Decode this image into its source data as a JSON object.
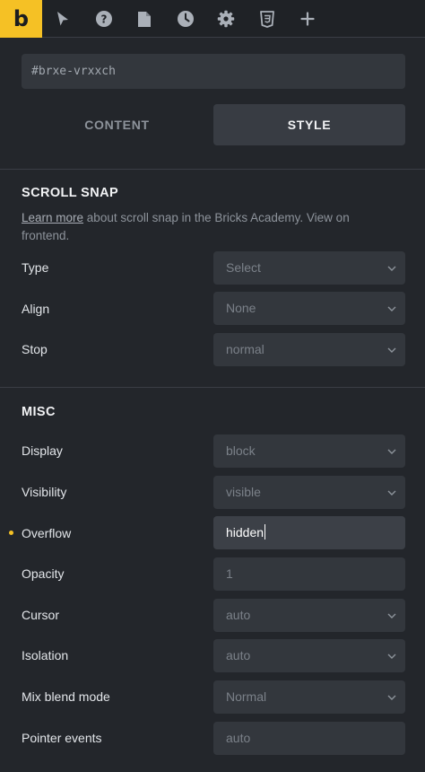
{
  "toolbar": {
    "logo_text": "b",
    "icons": [
      "pointer-icon",
      "help-icon",
      "page-icon",
      "history-icon",
      "settings-icon",
      "css-icon",
      "plus-icon"
    ]
  },
  "element_id": "#brxe-vrxxch",
  "tabs": [
    {
      "label": "CONTENT"
    },
    {
      "label": "STYLE"
    }
  ],
  "scroll_snap": {
    "title": "SCROLL SNAP",
    "learn_more": "Learn more",
    "description": " about scroll snap in the Bricks Academy. View on frontend.",
    "rows": [
      {
        "label": "Type",
        "value": "Select"
      },
      {
        "label": "Align",
        "value": "None"
      },
      {
        "label": "Stop",
        "value": "normal"
      }
    ]
  },
  "misc": {
    "title": "MISC",
    "rows": [
      {
        "label": "Display",
        "value": "block"
      },
      {
        "label": "Visibility",
        "value": "visible"
      },
      {
        "label": "Overflow",
        "value": "hidden"
      },
      {
        "label": "Opacity",
        "value": "1"
      },
      {
        "label": "Cursor",
        "value": "auto"
      },
      {
        "label": "Isolation",
        "value": "auto"
      },
      {
        "label": "Mix blend mode",
        "value": "Normal"
      },
      {
        "label": "Pointer events",
        "value": "auto"
      }
    ]
  },
  "colors": {
    "accent": "#f5c125",
    "background": "#23262b",
    "control": "#33373d"
  }
}
